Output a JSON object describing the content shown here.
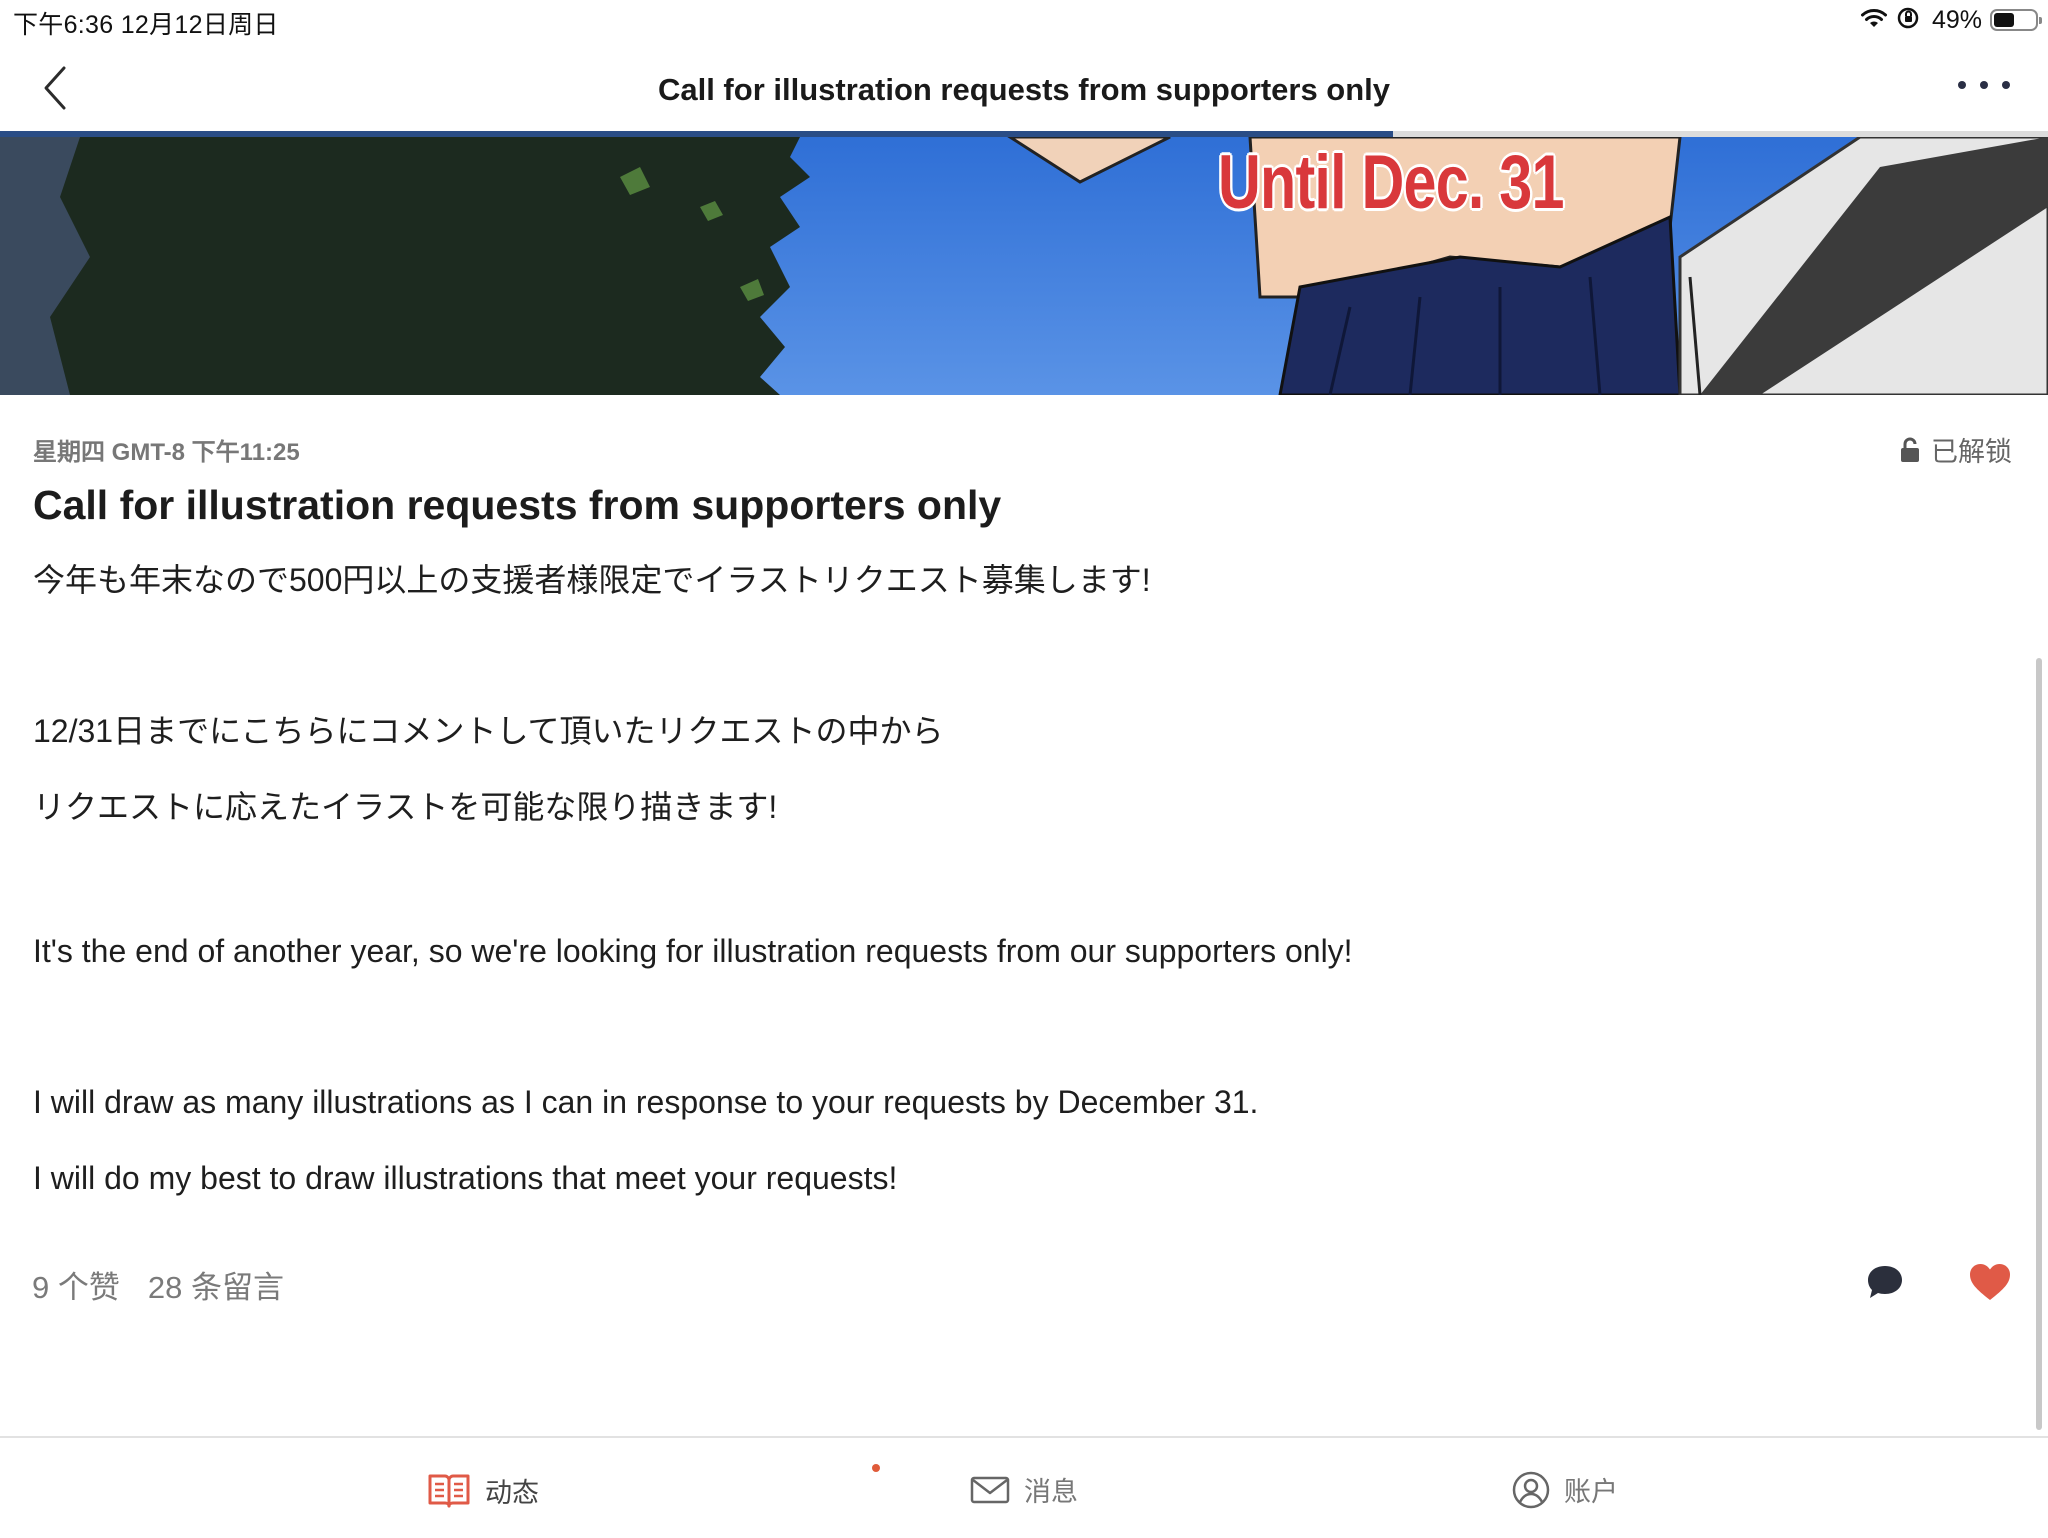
{
  "status_bar": {
    "time": "下午6:36   12月12日周日",
    "battery_percent": "49%",
    "battery_level": 0.49,
    "icons": [
      "wifi-icon",
      "orientation-lock-icon",
      "battery-icon"
    ]
  },
  "nav": {
    "title": "Call for illustration requests from supporters only",
    "read_progress": 0.68,
    "back_icon": "chevron-left-icon",
    "more_icon": "more-dots-icon"
  },
  "banner": {
    "text": "Until Dec. 31"
  },
  "post": {
    "timestamp": "星期四 GMT-8 下午11:25",
    "lock_status": "已解锁",
    "title": "Call for illustration requests from supporters only",
    "paragraphs": [
      "今年も年末なので500円以上の支援者様限定でイラストリクエスト募集します!",
      "12/31日までにこちらにコメントして頂いたリクエストの中から",
      "リクエストに応えたイラストを可能な限り描きます!",
      "It's the end of another year, so we're looking for illustration requests from our supporters only!",
      "I will draw as many illustrations as I can in response to your requests by December 31.",
      "I will do my best to draw illustrations that meet your requests!"
    ]
  },
  "stats": {
    "likes": "9 个赞",
    "comments": "28 条留言"
  },
  "actions": {
    "comment_icon": "comment-bubble-icon",
    "like_icon": "heart-icon",
    "like_color": "#e05a47"
  },
  "tabs": [
    {
      "label": "动态",
      "icon": "book-icon",
      "active": true
    },
    {
      "label": "消息",
      "icon": "mail-icon",
      "active": false
    },
    {
      "label": "账户",
      "icon": "account-icon",
      "active": false
    }
  ],
  "colors": {
    "accent": "#e05a47",
    "progress": "#2a4d86",
    "banner_text": "#d9383b"
  }
}
